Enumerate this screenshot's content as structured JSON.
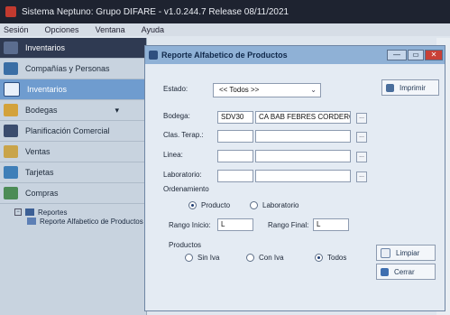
{
  "app": {
    "title": "Sistema Neptuno: Grupo DIFARE - v1.0.244.7 Release 08/11/2021"
  },
  "menu": [
    "Sesión",
    "Opciones",
    "Ventana",
    "Ayuda"
  ],
  "sidebar": {
    "items": [
      {
        "label": "Inventarios"
      },
      {
        "label": "Compañías y Personas"
      },
      {
        "label": "Inventarios"
      },
      {
        "label": "Bodegas"
      },
      {
        "label": "Planificación Comercial"
      },
      {
        "label": "Ventas"
      },
      {
        "label": "Tarjetas"
      },
      {
        "label": "Compras"
      }
    ],
    "tree": {
      "folder": "Reportes",
      "child": "Reporte Alfabetico de Productos"
    }
  },
  "dialog": {
    "title": "Reporte Alfabetico de Productos",
    "window_buttons": {
      "minimize": "—",
      "maximize": "▭",
      "close": "✕"
    },
    "estado": {
      "label": "Estado:",
      "value": "<< Todos >>"
    },
    "bodega": {
      "label": "Bodega:",
      "code": "SDV30",
      "name": "CA BAB FEBRES CORDERO"
    },
    "clas_terap": {
      "label": "Clas. Terap.:",
      "code": "",
      "name": ""
    },
    "linea": {
      "label": "Linea:",
      "code": "",
      "name": ""
    },
    "laboratorio": {
      "label": "Laboratorio:",
      "code": "",
      "name": ""
    },
    "dots": "...",
    "ordenamiento": {
      "label": "Ordenamiento",
      "options": [
        "Producto",
        "Laboratorio"
      ],
      "selected": "Producto"
    },
    "rango": {
      "inicio_label": "Rango Inicio:",
      "inicio_value": "L",
      "final_label": "Rango Final:",
      "final_value": "L"
    },
    "productos": {
      "label": "Productos",
      "options": [
        "Sin Iva",
        "Con Iva",
        "Todos"
      ],
      "selected": "Todos"
    },
    "buttons": {
      "imprimir": "Imprimir",
      "limpiar": "Limpiar",
      "cerrar": "Cerrar"
    }
  },
  "colors": {
    "titlebar": "#1e2330",
    "sidebar_active": "#6f9ccf",
    "dialog_title": "#8fb1d6",
    "close": "#c84037"
  }
}
